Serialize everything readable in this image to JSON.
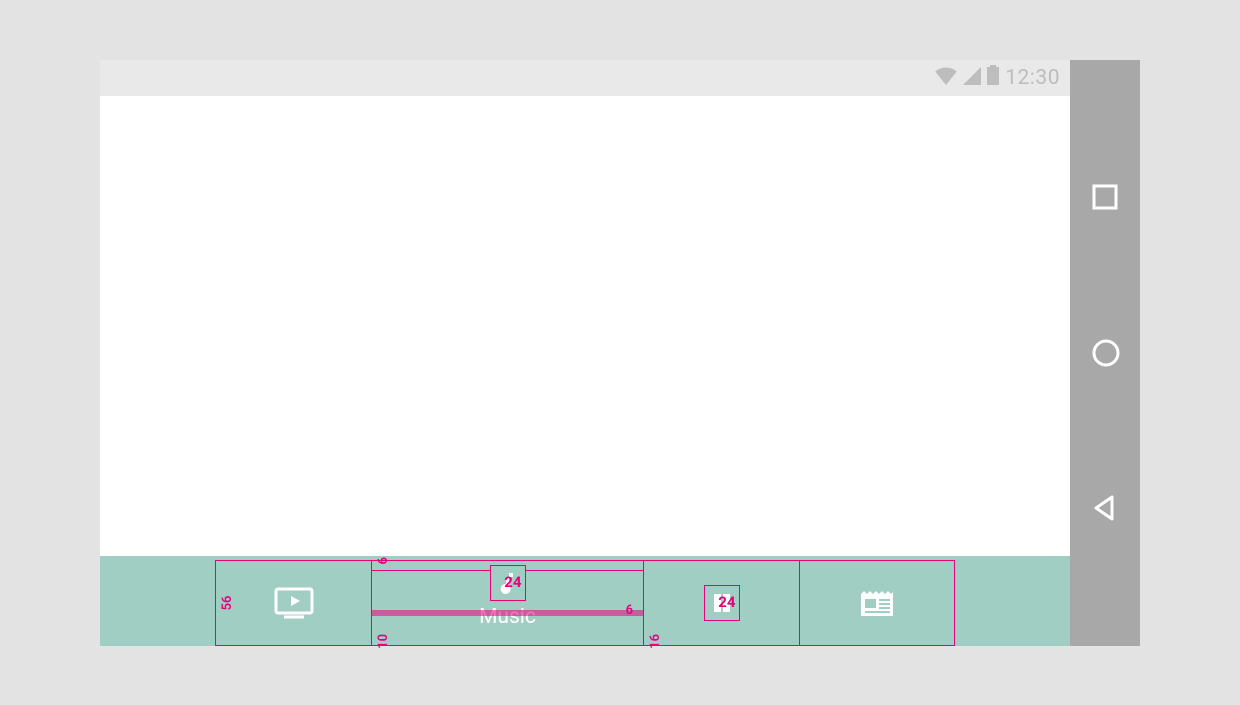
{
  "statusbar": {
    "time": "12:30"
  },
  "bottomnav": {
    "spec": {
      "height": "56",
      "top_pad": "6",
      "icon_label_gap": "6",
      "bottom_pad": "10",
      "inactive_bottom_pad": "16",
      "icon_size_active": "24",
      "icon_size_inactive": "24"
    },
    "tabs": [
      {
        "label": ""
      },
      {
        "label": "Music"
      },
      {
        "label": ""
      },
      {
        "label": ""
      }
    ]
  }
}
